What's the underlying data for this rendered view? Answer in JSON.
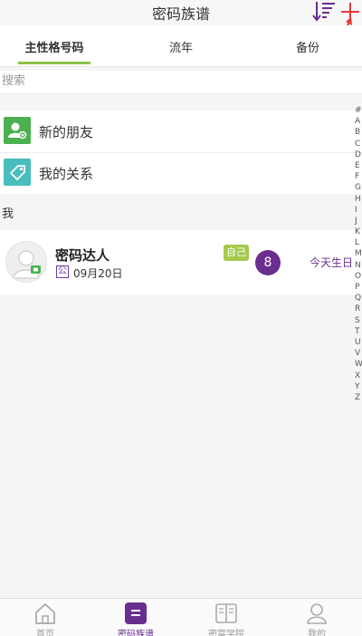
{
  "header": {
    "title": "密码族谱"
  },
  "tabs": [
    {
      "label": "主性格号码"
    },
    {
      "label": "流年"
    },
    {
      "label": "备份"
    }
  ],
  "search": {
    "placeholder": "搜索"
  },
  "menu": [
    {
      "label": "新的朋友",
      "icon": "new-friend-icon",
      "color": "#4cb050"
    },
    {
      "label": "我的关系",
      "icon": "tag-icon",
      "color": "#49bdbd"
    }
  ],
  "section": {
    "label": "我"
  },
  "contact": {
    "name": "密码达人",
    "tag": "公",
    "date": "09月20日",
    "self_badge": "自己",
    "number": "8",
    "birthday": "今天生日"
  },
  "index": [
    "#",
    "A",
    "B",
    "C",
    "D",
    "E",
    "F",
    "G",
    "H",
    "I",
    "J",
    "K",
    "L",
    "M",
    "N",
    "O",
    "P",
    "Q",
    "R",
    "S",
    "T",
    "U",
    "V",
    "W",
    "X",
    "Y",
    "Z"
  ],
  "bottom_nav": [
    {
      "label": "首页",
      "icon": "home-icon"
    },
    {
      "label": "密码族谱",
      "icon": "genealogy-icon"
    },
    {
      "label": "密富学院",
      "icon": "book-icon"
    },
    {
      "label": "我的",
      "icon": "profile-icon"
    }
  ],
  "colors": {
    "accent": "#6a2e8f",
    "tab_underline": "#8bc34a",
    "self_badge": "#a4c94b",
    "annotation_arrow": "#e53935"
  }
}
